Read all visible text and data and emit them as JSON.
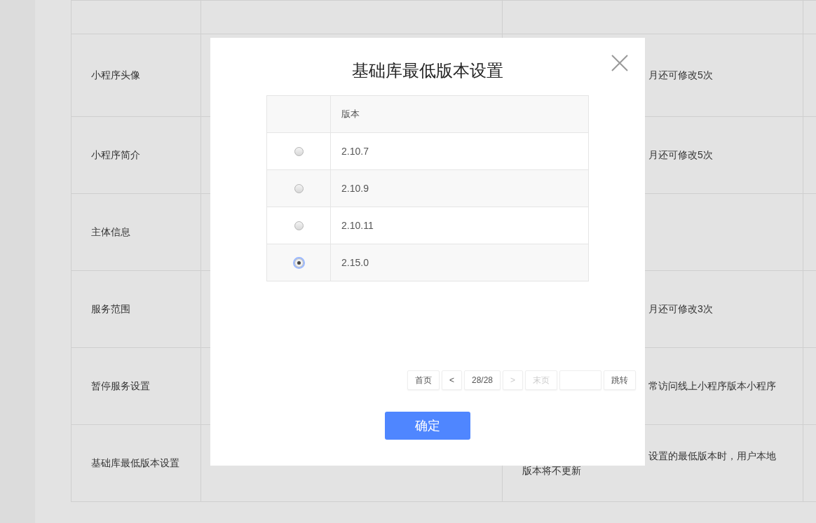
{
  "background_table": {
    "rows": [
      {
        "label": "小程序头像",
        "note": "月还可修改5次"
      },
      {
        "label": "小程序简介",
        "note": "月还可修改5次"
      },
      {
        "label": "主体信息"
      },
      {
        "label": "服务范围",
        "note": "月还可修改3次"
      },
      {
        "label": "暂停服务设置",
        "note": "常访问线上小程序版本小程序"
      },
      {
        "label": "基础库最低版本设置",
        "note": "设置的最低版本时，用户本地",
        "note_line_2": "版本将不更新"
      }
    ]
  },
  "dialog": {
    "title": "基础库最低版本设置",
    "columns": [
      "版本"
    ],
    "rows": [
      {
        "version": "2.10.7",
        "selected": false
      },
      {
        "version": "2.10.9",
        "selected": false
      },
      {
        "version": "2.10.11",
        "selected": false
      },
      {
        "version": "2.15.0",
        "selected": true
      }
    ],
    "pagination": [
      {
        "kind": "button",
        "label": "首页",
        "disabled": false
      },
      {
        "kind": "button",
        "label": "<",
        "disabled": false
      },
      {
        "kind": "button",
        "label": "28/28",
        "disabled": false
      },
      {
        "kind": "button",
        "label": ">",
        "disabled": true
      },
      {
        "kind": "button",
        "label": "末页",
        "disabled": true
      },
      {
        "kind": "input"
      },
      {
        "kind": "button",
        "label": "跳转",
        "disabled": false
      }
    ],
    "confirm": "确定"
  }
}
